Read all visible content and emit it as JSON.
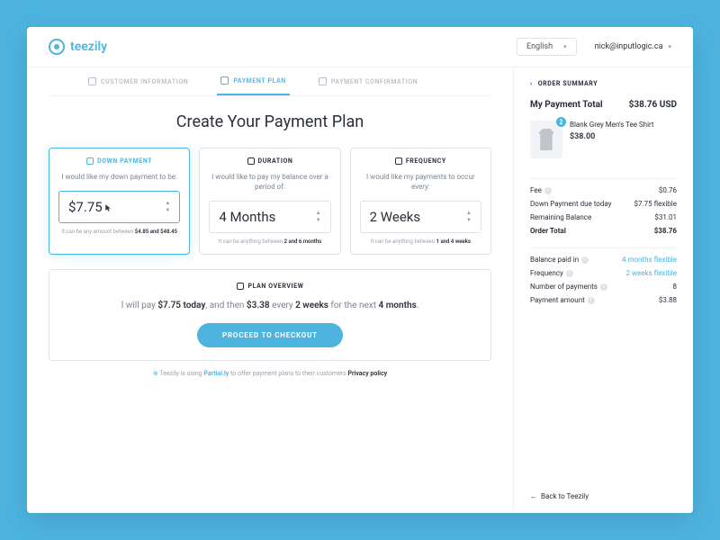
{
  "brand": "teezily",
  "lang": "English",
  "user": "nick@inputlogic.ca",
  "tabs": {
    "t0": "CUSTOMER INFORMATION",
    "t1": "PAYMENT PLAN",
    "t2": "PAYMENT CONFIRMATION"
  },
  "title": "Create Your Payment Plan",
  "down": {
    "h": "DOWN PAYMENT",
    "desc": "I would like my down payment to be:",
    "val": "$7.75",
    "hint_pre": "It can be any amount between ",
    "hint_b": "$4.85 and $48.45"
  },
  "dur": {
    "h": "DURATION",
    "desc": "I would like to pay my balance over a period of:",
    "val": "4 Months",
    "hint_pre": "It can be anything between ",
    "hint_b": "2 and 6 months"
  },
  "freq": {
    "h": "FREQUENCY",
    "desc": "I would like my payments to occur every:",
    "val": "2 Weeks",
    "hint_pre": "It can be anything between ",
    "hint_b": "1 and 4 weeks"
  },
  "ov": {
    "h": "PLAN OVERVIEW",
    "p0": "I will pay ",
    "p1": "$7.75 today",
    "p2": ", and then ",
    "p3": "$3.38",
    "p4": " every ",
    "p5": "2 weeks",
    "p6": " for the next ",
    "p7": "4 months",
    "p8": "."
  },
  "cta": "PROCEED TO CHECKOUT",
  "foot": {
    "a": "Teezily is using ",
    "b": "Partial.ly",
    "c": " to offer payment plans to their customers ",
    "d": "Privacy policy"
  },
  "side": {
    "h": "ORDER SUMMARY",
    "total_l": "My Payment Total",
    "total_v": "$38.76 USD",
    "prod_name": "Blank Grey Men's Tee Shirt",
    "prod_price": "$38.00",
    "qty": "2",
    "r0l": "Fee",
    "r0v": "$0.76",
    "r1l": "Down Payment due today",
    "r1v": "$7.75 flexible",
    "r2l": "Remaining Balance",
    "r2v": "$31.01",
    "r3l": "Order Total",
    "r3v": "$38.76",
    "r4l": "Balance paid in",
    "r4v": "4 months flexible",
    "r5l": "Frequency",
    "r5v": "2 weeks flexible",
    "r6l": "Number of payments",
    "r6v": "8",
    "r7l": "Payment amount",
    "r7v": "$3.88",
    "back": "Back to Teezily"
  }
}
